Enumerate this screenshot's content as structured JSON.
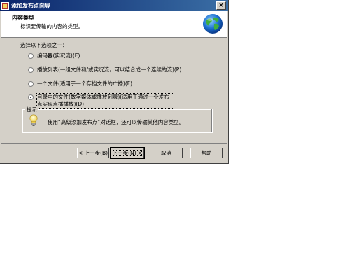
{
  "window": {
    "title": "添加发布点向导",
    "close_glyph": "×"
  },
  "header": {
    "title": "内容类型",
    "subtitle": "标识要传输的内容的类型。",
    "icon": "globe-icon"
  },
  "body": {
    "prompt": "选择以下选项之一：",
    "options": [
      {
        "label": "编码器(实况流)(E)",
        "selected": false
      },
      {
        "label": "播放列表(一组文件和/或实况流，可以结合成一个连续的流)(P)",
        "selected": false
      },
      {
        "label": "一个文件(适用于一个存档文件的广播)(F)",
        "selected": false
      },
      {
        "label": "目录中的文件(数字媒体或播放列表)(适用于通过一个发布点实现点播播放)(D)",
        "selected": true
      }
    ],
    "hint": {
      "legend": "提示",
      "text": "使用“高级添加发布点”对话框，还可以传输其他内容类型。",
      "icon": "lightbulb-icon"
    }
  },
  "buttons": {
    "back": "< 上一步(B)",
    "next": "下一步(N) >",
    "cancel": "取消",
    "help": "帮助"
  }
}
